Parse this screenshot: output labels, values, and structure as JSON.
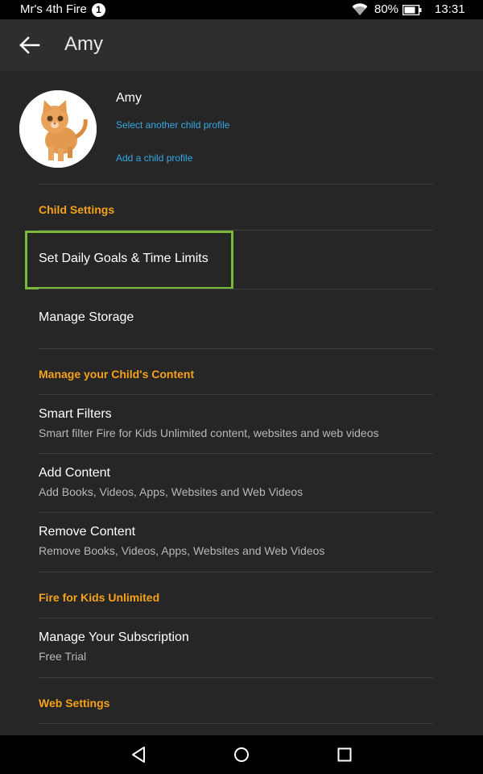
{
  "status_bar": {
    "device_name": "Mr's 4th Fire",
    "notification_count": "1",
    "battery_percent": "80%",
    "time": "13:31"
  },
  "app_bar": {
    "title": "Amy"
  },
  "profile": {
    "name": "Amy",
    "select_link": "Select another child profile",
    "add_link": "Add a child profile",
    "avatar": "kitten-photo"
  },
  "sections": {
    "child_settings": "Child Settings",
    "content": "Manage your Child's Content",
    "unlimited": "Fire for Kids Unlimited",
    "web": "Web Settings"
  },
  "rows": {
    "daily_goals": {
      "title": "Set Daily Goals & Time Limits"
    },
    "storage": {
      "title": "Manage Storage"
    },
    "smart_filters": {
      "title": "Smart Filters",
      "subtitle": "Smart filter Fire for Kids Unlimited content, websites and web videos"
    },
    "add_content": {
      "title": "Add Content",
      "subtitle": "Add Books, Videos, Apps, Websites and Web Videos"
    },
    "remove_content": {
      "title": "Remove Content",
      "subtitle": "Remove Books, Videos, Apps, Websites and Web Videos"
    },
    "subscription": {
      "title": "Manage Your Subscription",
      "subtitle": "Free Trial"
    }
  },
  "colors": {
    "accent_section": "#f6a11a",
    "link": "#35a9e6",
    "highlight": "#79b93a",
    "background": "#262626"
  },
  "icons": {
    "back": "arrow-back-icon",
    "nav_back": "triangle-back-icon",
    "nav_home": "circle-home-icon",
    "nav_recents": "square-recents-icon"
  }
}
